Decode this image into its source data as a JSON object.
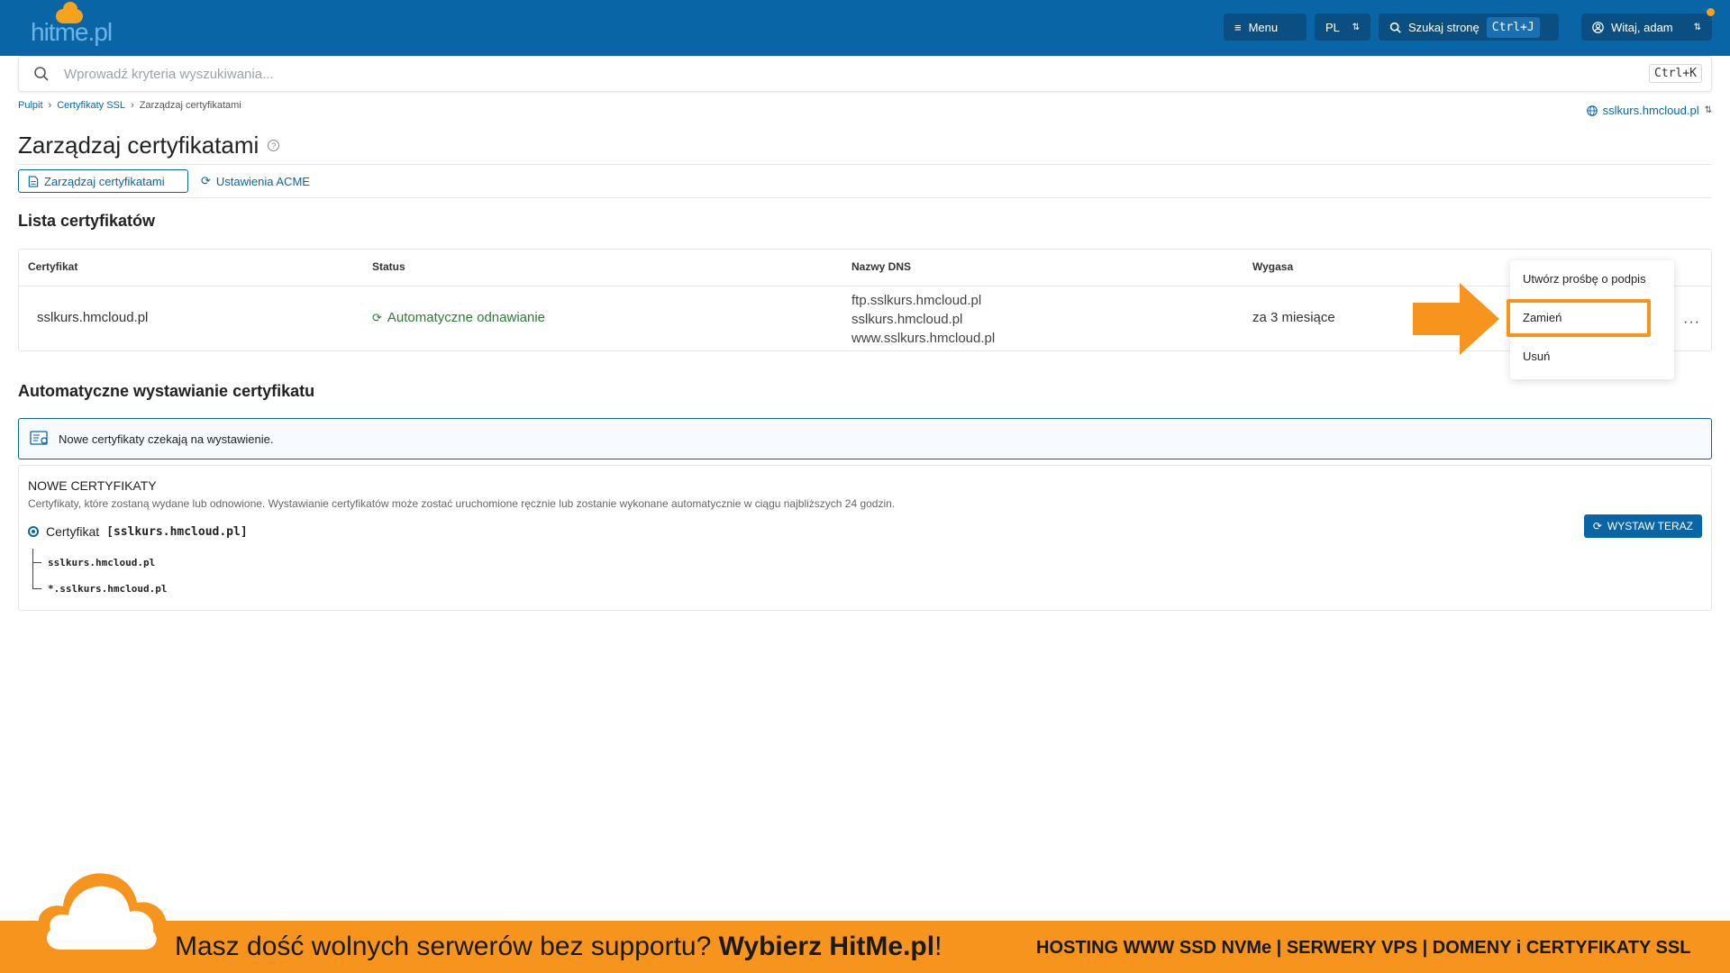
{
  "header": {
    "logo_text": "hitme.pl",
    "menu_label": "Menu",
    "lang_label": "PL",
    "search_label": "Szukaj stronę",
    "search_shortcut": "Ctrl+J",
    "user_label": "Witaj, adam"
  },
  "search": {
    "placeholder": "Wprowadź kryteria wyszukiwania...",
    "shortcut": "Ctrl+K"
  },
  "breadcrumb": {
    "items": [
      "Pulpit",
      "Certyfikaty SSL",
      "Zarządzaj certyfikatami"
    ],
    "separator": "›"
  },
  "domain_selector": "sslkurs.hmcloud.pl",
  "page": {
    "title": "Zarządzaj certyfikatami",
    "tabs": [
      {
        "label": "Zarządzaj certyfikatami",
        "active": true
      },
      {
        "label": "Ustawienia ACME",
        "active": false
      }
    ]
  },
  "cert_list": {
    "title": "Lista certyfikatów",
    "columns": [
      "Certyfikat",
      "Status",
      "Nazwy DNS",
      "Wygasa"
    ],
    "rows": [
      {
        "certificate": "sslkurs.hmcloud.pl",
        "status": "Automatyczne odnawianie",
        "dns": [
          "ftp.sslkurs.hmcloud.pl",
          "sslkurs.hmcloud.pl",
          "www.sslkurs.hmcloud.pl"
        ],
        "expires": "za 3 miesiące"
      }
    ],
    "row_menu_label": "···",
    "dropdown": [
      "Utwórz prośbę o podpis",
      "Zamień",
      "Usuń"
    ]
  },
  "auto_issue": {
    "title": "Automatyczne wystawianie certyfikatu",
    "info": "Nowe certyfikaty czekają na wystawienie.",
    "panel_title": "NOWE CERTYFIKATY",
    "panel_desc": "Certyfikaty, które zostaną wydane lub odnowione. Wystawianie certyfikatów może zostać uruchomione ręcznie lub zostanie wykonane automatycznie w ciągu najbliższych 24 godzin.",
    "cert_label": "Certyfikat",
    "cert_name": "[sslkurs.hmcloud.pl]",
    "cert_domains": [
      "sslkurs.hmcloud.pl",
      "*.sslkurs.hmcloud.pl"
    ],
    "issue_button": "WYSTAW TERAZ"
  },
  "banner": {
    "main_text": "Masz dość wolnych serwerów bez supportu? ",
    "main_bold": "Wybierz HitMe.pl",
    "main_end": "!",
    "right_text": "HOSTING WWW SSD NVMe | SERWERY VPS | DOMENY i CERTYFIKATY SSL"
  },
  "colors": {
    "primary": "#0a65a6",
    "accent": "#f7941d",
    "success": "#2d7a3a"
  }
}
